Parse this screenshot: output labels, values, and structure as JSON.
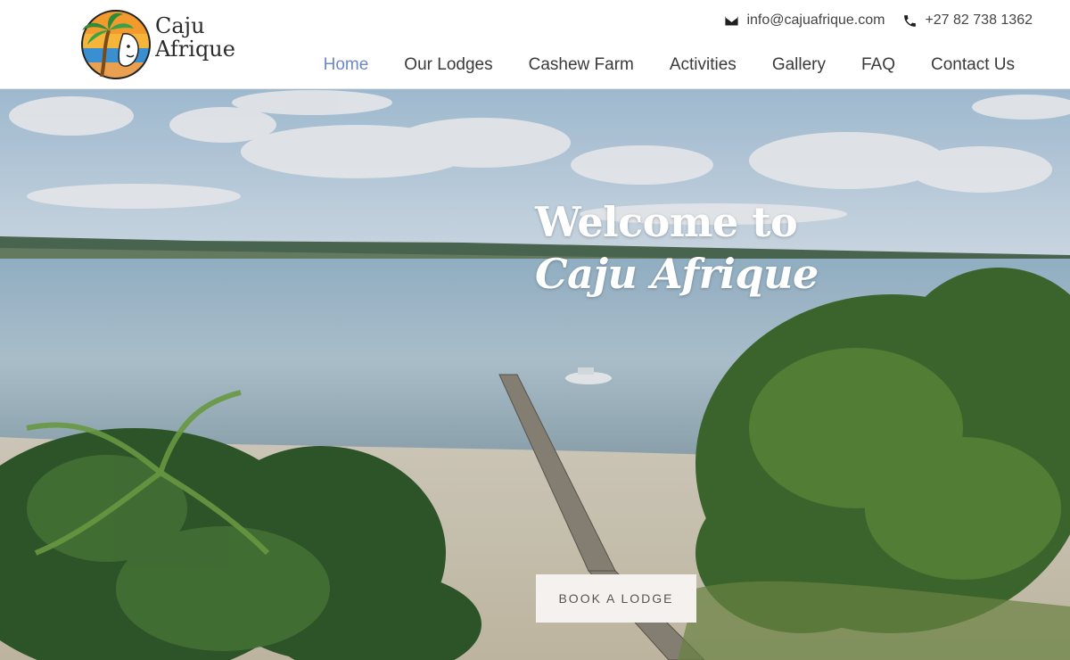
{
  "brand": {
    "line1": "Caju",
    "line2": "Afrique"
  },
  "contact": {
    "email": "info@cajuafrique.com",
    "phone": "+27 82 738 1362",
    "email_icon": "envelope-icon",
    "phone_icon": "phone-icon"
  },
  "nav": {
    "items": [
      {
        "label": "Home",
        "active": true
      },
      {
        "label": "Our Lodges"
      },
      {
        "label": "Cashew Farm"
      },
      {
        "label": "Activities"
      },
      {
        "label": "Gallery"
      },
      {
        "label": "FAQ"
      },
      {
        "label": "Contact Us"
      }
    ]
  },
  "hero": {
    "title_line1": "Welcome to",
    "title_line2": "Caju Afrique",
    "cta_label": "BOOK A LODGE"
  },
  "colors": {
    "nav_active": "#6f86c8",
    "nav_text": "#3a3a3a",
    "cta_bg": "#f4f1ee"
  }
}
